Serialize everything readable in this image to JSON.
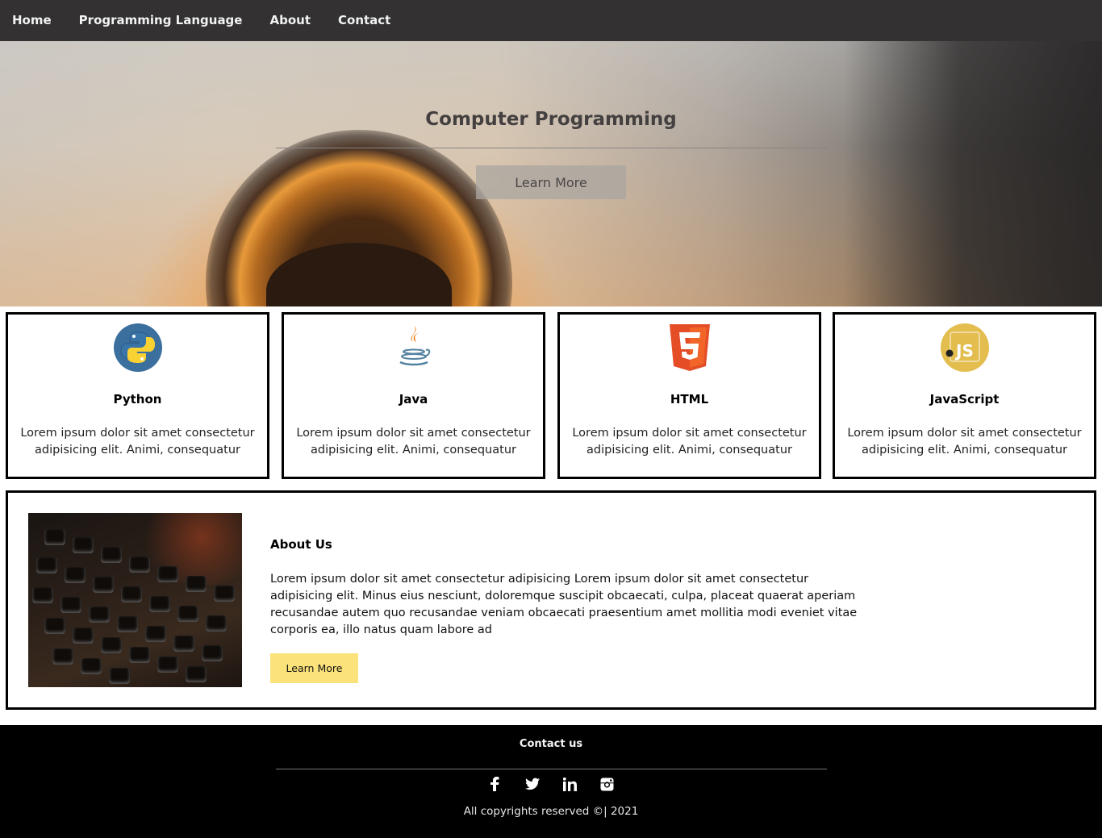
{
  "nav": {
    "items": [
      {
        "label": "Home"
      },
      {
        "label": "Programming Language"
      },
      {
        "label": "About"
      },
      {
        "label": "Contact"
      }
    ]
  },
  "hero": {
    "title": "Computer Programming",
    "button_label": "Learn More"
  },
  "cards": [
    {
      "title": "Python",
      "icon": "python-icon",
      "text": "Lorem ipsum dolor sit amet consectetur adipisicing elit. Animi, consequatur"
    },
    {
      "title": "Java",
      "icon": "java-icon",
      "text": "Lorem ipsum dolor sit amet consectetur adipisicing elit. Animi, consequatur"
    },
    {
      "title": "HTML",
      "icon": "html5-icon",
      "text": "Lorem ipsum dolor sit amet consectetur adipisicing elit. Animi, consequatur"
    },
    {
      "title": "JavaScript",
      "icon": "javascript-icon",
      "text": "Lorem ipsum dolor sit amet consectetur adipisicing elit. Animi, consequatur"
    }
  ],
  "about": {
    "title": "About Us",
    "text": "Lorem ipsum dolor sit amet consectetur adipisicing Lorem ipsum dolor sit amet consectetur adipisicing elit. Minus eius nesciunt, doloremque suscipit obcaecati, culpa, placeat quaerat aperiam recusandae autem quo recusandae veniam obcaecati praesentium amet mollitia modi eveniet vitae corporis ea, illo natus quam labore ad",
    "button_label": "Learn More",
    "button_color": "#fbe27a"
  },
  "footer": {
    "title": "Contact us",
    "socials": [
      "facebook-icon",
      "twitter-icon",
      "linkedin-icon",
      "instagram-icon"
    ],
    "copyright": "All copyrights reserved ©| 2021"
  },
  "colors": {
    "nav_bg": "#333132",
    "footer_bg": "#000000",
    "card_border": "#000000"
  }
}
